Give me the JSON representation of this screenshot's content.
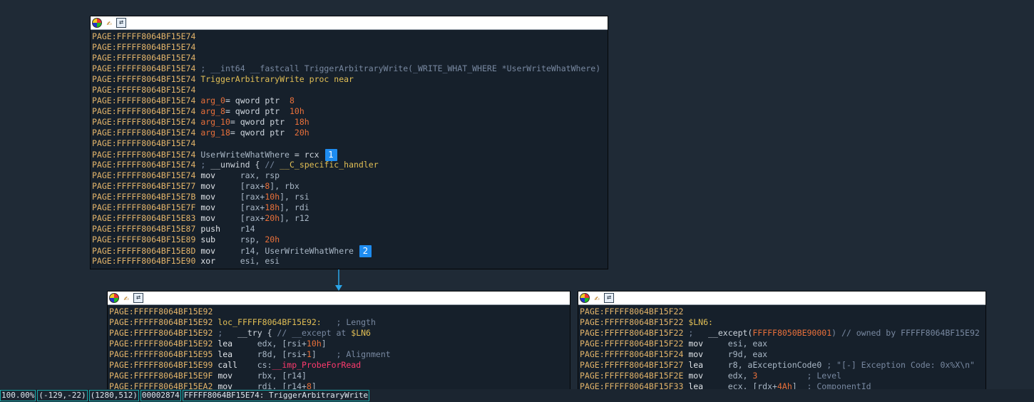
{
  "nodes": {
    "top": {
      "lines": [
        [
          {
            "t": "PAGE:FFFFF8064BF15E74",
            "c": "addr"
          }
        ],
        [
          {
            "t": "PAGE:FFFFF8064BF15E74",
            "c": "addr"
          }
        ],
        [
          {
            "t": "PAGE:FFFFF8064BF15E74",
            "c": "addr"
          }
        ],
        [
          {
            "t": "PAGE:FFFFF8064BF15E74",
            "c": "addr"
          },
          {
            "t": " ; __int64 __fastcall TriggerArbitraryWrite(_WRITE_WHAT_WHERE *UserWriteWhatWhere)",
            "c": "comment"
          }
        ],
        [
          {
            "t": "PAGE:FFFFF8064BF15E74",
            "c": "addr"
          },
          {
            "t": " TriggerArbitraryWrite proc near",
            "c": "var"
          }
        ],
        [
          {
            "t": "PAGE:FFFFF8064BF15E74",
            "c": "addr"
          }
        ],
        [
          {
            "t": "PAGE:FFFFF8064BF15E74",
            "c": "addr"
          },
          {
            "t": " arg_0",
            "c": "num"
          },
          {
            "t": "= qword ptr  ",
            "c": "plain"
          },
          {
            "t": "8",
            "c": "num"
          }
        ],
        [
          {
            "t": "PAGE:FFFFF8064BF15E74",
            "c": "addr"
          },
          {
            "t": " arg_8",
            "c": "num"
          },
          {
            "t": "= qword ptr  ",
            "c": "plain"
          },
          {
            "t": "10h",
            "c": "num"
          }
        ],
        [
          {
            "t": "PAGE:FFFFF8064BF15E74",
            "c": "addr"
          },
          {
            "t": " arg_10",
            "c": "num"
          },
          {
            "t": "= qword ptr  ",
            "c": "plain"
          },
          {
            "t": "18h",
            "c": "num"
          }
        ],
        [
          {
            "t": "PAGE:FFFFF8064BF15E74",
            "c": "addr"
          },
          {
            "t": " arg_18",
            "c": "num"
          },
          {
            "t": "= qword ptr  ",
            "c": "plain"
          },
          {
            "t": "20h",
            "c": "num"
          }
        ],
        [
          {
            "t": "PAGE:FFFFF8064BF15E74",
            "c": "addr"
          }
        ],
        [
          {
            "t": "PAGE:FFFFF8064BF15E74",
            "c": "addr"
          },
          {
            "t": " UserWriteWhatWhere",
            "c": "reg"
          },
          {
            "t": " = rcx",
            "c": "plain"
          },
          {
            "badge": "1"
          }
        ],
        [
          {
            "t": "PAGE:FFFFF8064BF15E74",
            "c": "addr"
          },
          {
            "t": " ; ",
            "c": "comment"
          },
          {
            "t": "__unwind { ",
            "c": "plain"
          },
          {
            "t": "// ",
            "c": "comment"
          },
          {
            "t": "__C_specific_handler",
            "c": "var"
          }
        ],
        [
          {
            "t": "PAGE:FFFFF8064BF15E74",
            "c": "addr"
          },
          {
            "t": " mov     ",
            "c": "mn"
          },
          {
            "t": "rax, rsp",
            "c": "reg"
          }
        ],
        [
          {
            "t": "PAGE:FFFFF8064BF15E77",
            "c": "addr"
          },
          {
            "t": " mov     ",
            "c": "mn"
          },
          {
            "t": "[rax+",
            "c": "reg"
          },
          {
            "t": "8",
            "c": "num"
          },
          {
            "t": "], rbx",
            "c": "reg"
          }
        ],
        [
          {
            "t": "PAGE:FFFFF8064BF15E7B",
            "c": "addr"
          },
          {
            "t": " mov     ",
            "c": "mn"
          },
          {
            "t": "[rax+",
            "c": "reg"
          },
          {
            "t": "10h",
            "c": "num"
          },
          {
            "t": "], rsi",
            "c": "reg"
          }
        ],
        [
          {
            "t": "PAGE:FFFFF8064BF15E7F",
            "c": "addr"
          },
          {
            "t": " mov     ",
            "c": "mn"
          },
          {
            "t": "[rax+",
            "c": "reg"
          },
          {
            "t": "18h",
            "c": "num"
          },
          {
            "t": "], rdi",
            "c": "reg"
          }
        ],
        [
          {
            "t": "PAGE:FFFFF8064BF15E83",
            "c": "addr"
          },
          {
            "t": " mov     ",
            "c": "mn"
          },
          {
            "t": "[rax+",
            "c": "reg"
          },
          {
            "t": "20h",
            "c": "num"
          },
          {
            "t": "], r12",
            "c": "reg"
          }
        ],
        [
          {
            "t": "PAGE:FFFFF8064BF15E87",
            "c": "addr"
          },
          {
            "t": " push    ",
            "c": "mn"
          },
          {
            "t": "r14",
            "c": "reg"
          }
        ],
        [
          {
            "t": "PAGE:FFFFF8064BF15E89",
            "c": "addr"
          },
          {
            "t": " sub     ",
            "c": "mn"
          },
          {
            "t": "rsp, ",
            "c": "reg"
          },
          {
            "t": "20h",
            "c": "num"
          }
        ],
        [
          {
            "t": "PAGE:FFFFF8064BF15E8D",
            "c": "addr"
          },
          {
            "t": " mov     ",
            "c": "mn"
          },
          {
            "t": "r14, UserWriteWhatWhere",
            "c": "reg"
          },
          {
            "badge": "2"
          }
        ],
        [
          {
            "t": "PAGE:FFFFF8064BF15E90",
            "c": "addr"
          },
          {
            "t": " xor     ",
            "c": "mn"
          },
          {
            "t": "esi, esi",
            "c": "reg"
          }
        ]
      ]
    },
    "left": {
      "lines": [
        [
          {
            "t": "PAGE:FFFFF8064BF15E92",
            "c": "addr"
          }
        ],
        [
          {
            "t": "PAGE:FFFFF8064BF15E92",
            "c": "addr"
          },
          {
            "t": " loc_FFFFF8064BF15E92:",
            "c": "var"
          },
          {
            "t": "   ; Length",
            "c": "comment"
          }
        ],
        [
          {
            "t": "PAGE:FFFFF8064BF15E92",
            "c": "addr"
          },
          {
            "t": " ;   ",
            "c": "comment"
          },
          {
            "t": "__try { ",
            "c": "plain"
          },
          {
            "t": "// __except at ",
            "c": "comment"
          },
          {
            "t": "$LN6",
            "c": "var"
          }
        ],
        [
          {
            "t": "PAGE:FFFFF8064BF15E92",
            "c": "addr"
          },
          {
            "t": " lea     ",
            "c": "mn"
          },
          {
            "t": "edx, [rsi+",
            "c": "reg"
          },
          {
            "t": "10h",
            "c": "num"
          },
          {
            "t": "]",
            "c": "reg"
          }
        ],
        [
          {
            "t": "PAGE:FFFFF8064BF15E95",
            "c": "addr"
          },
          {
            "t": " lea     ",
            "c": "mn"
          },
          {
            "t": "r8d, [rsi+",
            "c": "reg"
          },
          {
            "t": "1",
            "c": "num"
          },
          {
            "t": "]",
            "c": "reg"
          },
          {
            "t": "    ; Alignment",
            "c": "comment"
          }
        ],
        [
          {
            "t": "PAGE:FFFFF8064BF15E99",
            "c": "addr"
          },
          {
            "t": " call    ",
            "c": "mn"
          },
          {
            "t": "cs:",
            "c": "reg"
          },
          {
            "t": "__imp_ProbeForRead",
            "c": "func"
          }
        ],
        [
          {
            "t": "PAGE:FFFFF8064BF15E9F",
            "c": "addr"
          },
          {
            "t": " mov     ",
            "c": "mn"
          },
          {
            "t": "rbx, [r14]",
            "c": "reg"
          }
        ],
        [
          {
            "t": "PAGE:FFFFF8064BF15EA2",
            "c": "addr"
          },
          {
            "t": " mov     ",
            "c": "mn"
          },
          {
            "t": "rdi, [r14+",
            "c": "reg"
          },
          {
            "t": "8",
            "c": "num"
          },
          {
            "t": "]",
            "c": "reg"
          }
        ]
      ]
    },
    "right": {
      "lines": [
        [
          {
            "t": "PAGE:FFFFF8064BF15F22",
            "c": "addr"
          }
        ],
        [
          {
            "t": "PAGE:FFFFF8064BF15F22",
            "c": "addr"
          },
          {
            "t": " $LN6:",
            "c": "var"
          }
        ],
        [
          {
            "t": "PAGE:FFFFF8064BF15F22",
            "c": "addr"
          },
          {
            "t": " ;   ",
            "c": "comment"
          },
          {
            "t": "__except(",
            "c": "plain"
          },
          {
            "t": "FFFFF8050BE90001",
            "c": "num"
          },
          {
            "t": ") // owned by FFFFF8064BF15E92",
            "c": "comment"
          }
        ],
        [
          {
            "t": "PAGE:FFFFF8064BF15F22",
            "c": "addr"
          },
          {
            "t": " mov     ",
            "c": "mn"
          },
          {
            "t": "esi, eax",
            "c": "reg"
          }
        ],
        [
          {
            "t": "PAGE:FFFFF8064BF15F24",
            "c": "addr"
          },
          {
            "t": " mov     ",
            "c": "mn"
          },
          {
            "t": "r9d, eax",
            "c": "reg"
          }
        ],
        [
          {
            "t": "PAGE:FFFFF8064BF15F27",
            "c": "addr"
          },
          {
            "t": " lea     ",
            "c": "mn"
          },
          {
            "t": "r8, aExceptionCode0 ",
            "c": "reg"
          },
          {
            "t": "; \"[-] Exception Code: 0x%X\\n\"",
            "c": "comment"
          }
        ],
        [
          {
            "t": "PAGE:FFFFF8064BF15F2E",
            "c": "addr"
          },
          {
            "t": " mov     ",
            "c": "mn"
          },
          {
            "t": "edx, ",
            "c": "reg"
          },
          {
            "t": "3",
            "c": "num"
          },
          {
            "t": "          ; Level",
            "c": "comment"
          }
        ],
        [
          {
            "t": "PAGE:FFFFF8064BF15F33",
            "c": "addr"
          },
          {
            "t": " lea     ",
            "c": "mn"
          },
          {
            "t": "ecx, [rdx+",
            "c": "reg"
          },
          {
            "t": "4Ah",
            "c": "num"
          },
          {
            "t": "]",
            "c": "reg"
          },
          {
            "t": "  ; ComponentId",
            "c": "comment"
          }
        ]
      ]
    }
  },
  "header_icons": {
    "color": "color-palette-icon",
    "rename": "rename-icon",
    "graph": "graph-overview-icon"
  },
  "statusbar": {
    "zoom": "100.00%",
    "mouse": "(-129,-22)",
    "view": "(1280,512)",
    "offset": "00002874",
    "location": "FFFFF8064BF15E74: TriggerArbitraryWrite"
  },
  "colors": {
    "edge": "#2aa4e8",
    "badge": "#1e8cf0",
    "background": "#1f2a36"
  }
}
